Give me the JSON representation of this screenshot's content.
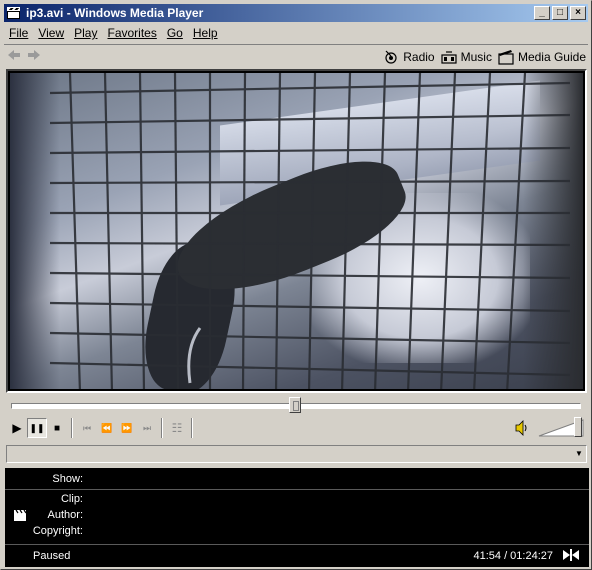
{
  "window": {
    "title": "ip3.avi - Windows Media Player",
    "minimize": "_",
    "maximize": "□",
    "close": "×"
  },
  "menu": [
    {
      "label": "File"
    },
    {
      "label": "View"
    },
    {
      "label": "Play"
    },
    {
      "label": "Favorites"
    },
    {
      "label": "Go"
    },
    {
      "label": "Help"
    }
  ],
  "nav": {
    "back_icon": "back-arrow-icon",
    "forward_icon": "forward-arrow-icon",
    "links": [
      {
        "label": "Radio",
        "icon": "radio-icon"
      },
      {
        "label": "Music",
        "icon": "music-icon"
      },
      {
        "label": "Media Guide",
        "icon": "media-guide-icon"
      }
    ]
  },
  "playback": {
    "seek_position": 0.498,
    "volume_level": 0.95
  },
  "transport": {
    "play": "▶",
    "pause": "❚❚",
    "stop": "■",
    "skip_back": "⏮",
    "rewind": "⏪",
    "fast_forward": "⏩",
    "skip_forward": "⏭",
    "playlist": "☷"
  },
  "info": {
    "show_label": "Show:",
    "show_value": "",
    "clip_label": "Clip:",
    "clip_value": "",
    "author_label": "Author:",
    "author_value": "",
    "copyright_label": "Copyright:",
    "copyright_value": "",
    "status": "Paused",
    "time": "41:54 / 01:24:27"
  },
  "colors": {
    "title_start": "#0a246a",
    "title_end": "#a6caf0",
    "face": "#d4d0c8",
    "info_bg": "#000000"
  }
}
